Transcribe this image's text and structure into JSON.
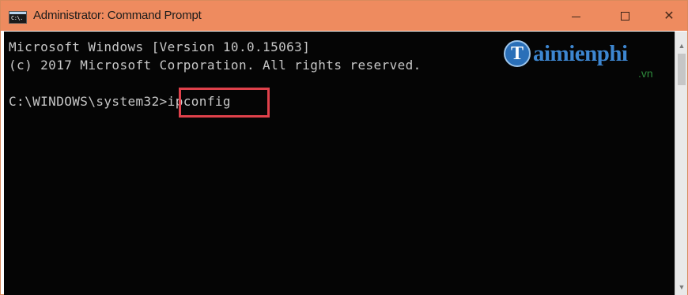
{
  "window": {
    "title": "Administrator: Command Prompt",
    "icon": "command-prompt-icon",
    "icon_text": "C:\\.",
    "controls": {
      "minimize": "minimize-icon",
      "maximize": "maximize-icon",
      "close": "close-icon",
      "close_glyph": "✕"
    }
  },
  "console": {
    "lines": [
      "Microsoft Windows [Version 10.0.15063]",
      "(c) 2017 Microsoft Corporation. All rights reserved.",
      "C:\\WINDOWS\\system32>ipconfig"
    ],
    "prompt": "C:\\WINDOWS\\system32>",
    "command": "ipconfig"
  },
  "watermark": {
    "logo_letter": "T",
    "name": "aimienphi",
    "suffix": ".vn"
  },
  "scrollbar": {
    "up_glyph": "▲",
    "down_glyph": "▼"
  },
  "colors": {
    "titlebar": "#ee8b5f",
    "console_bg": "#050505",
    "console_text": "#c7c7c7",
    "highlight": "#e0414b"
  }
}
